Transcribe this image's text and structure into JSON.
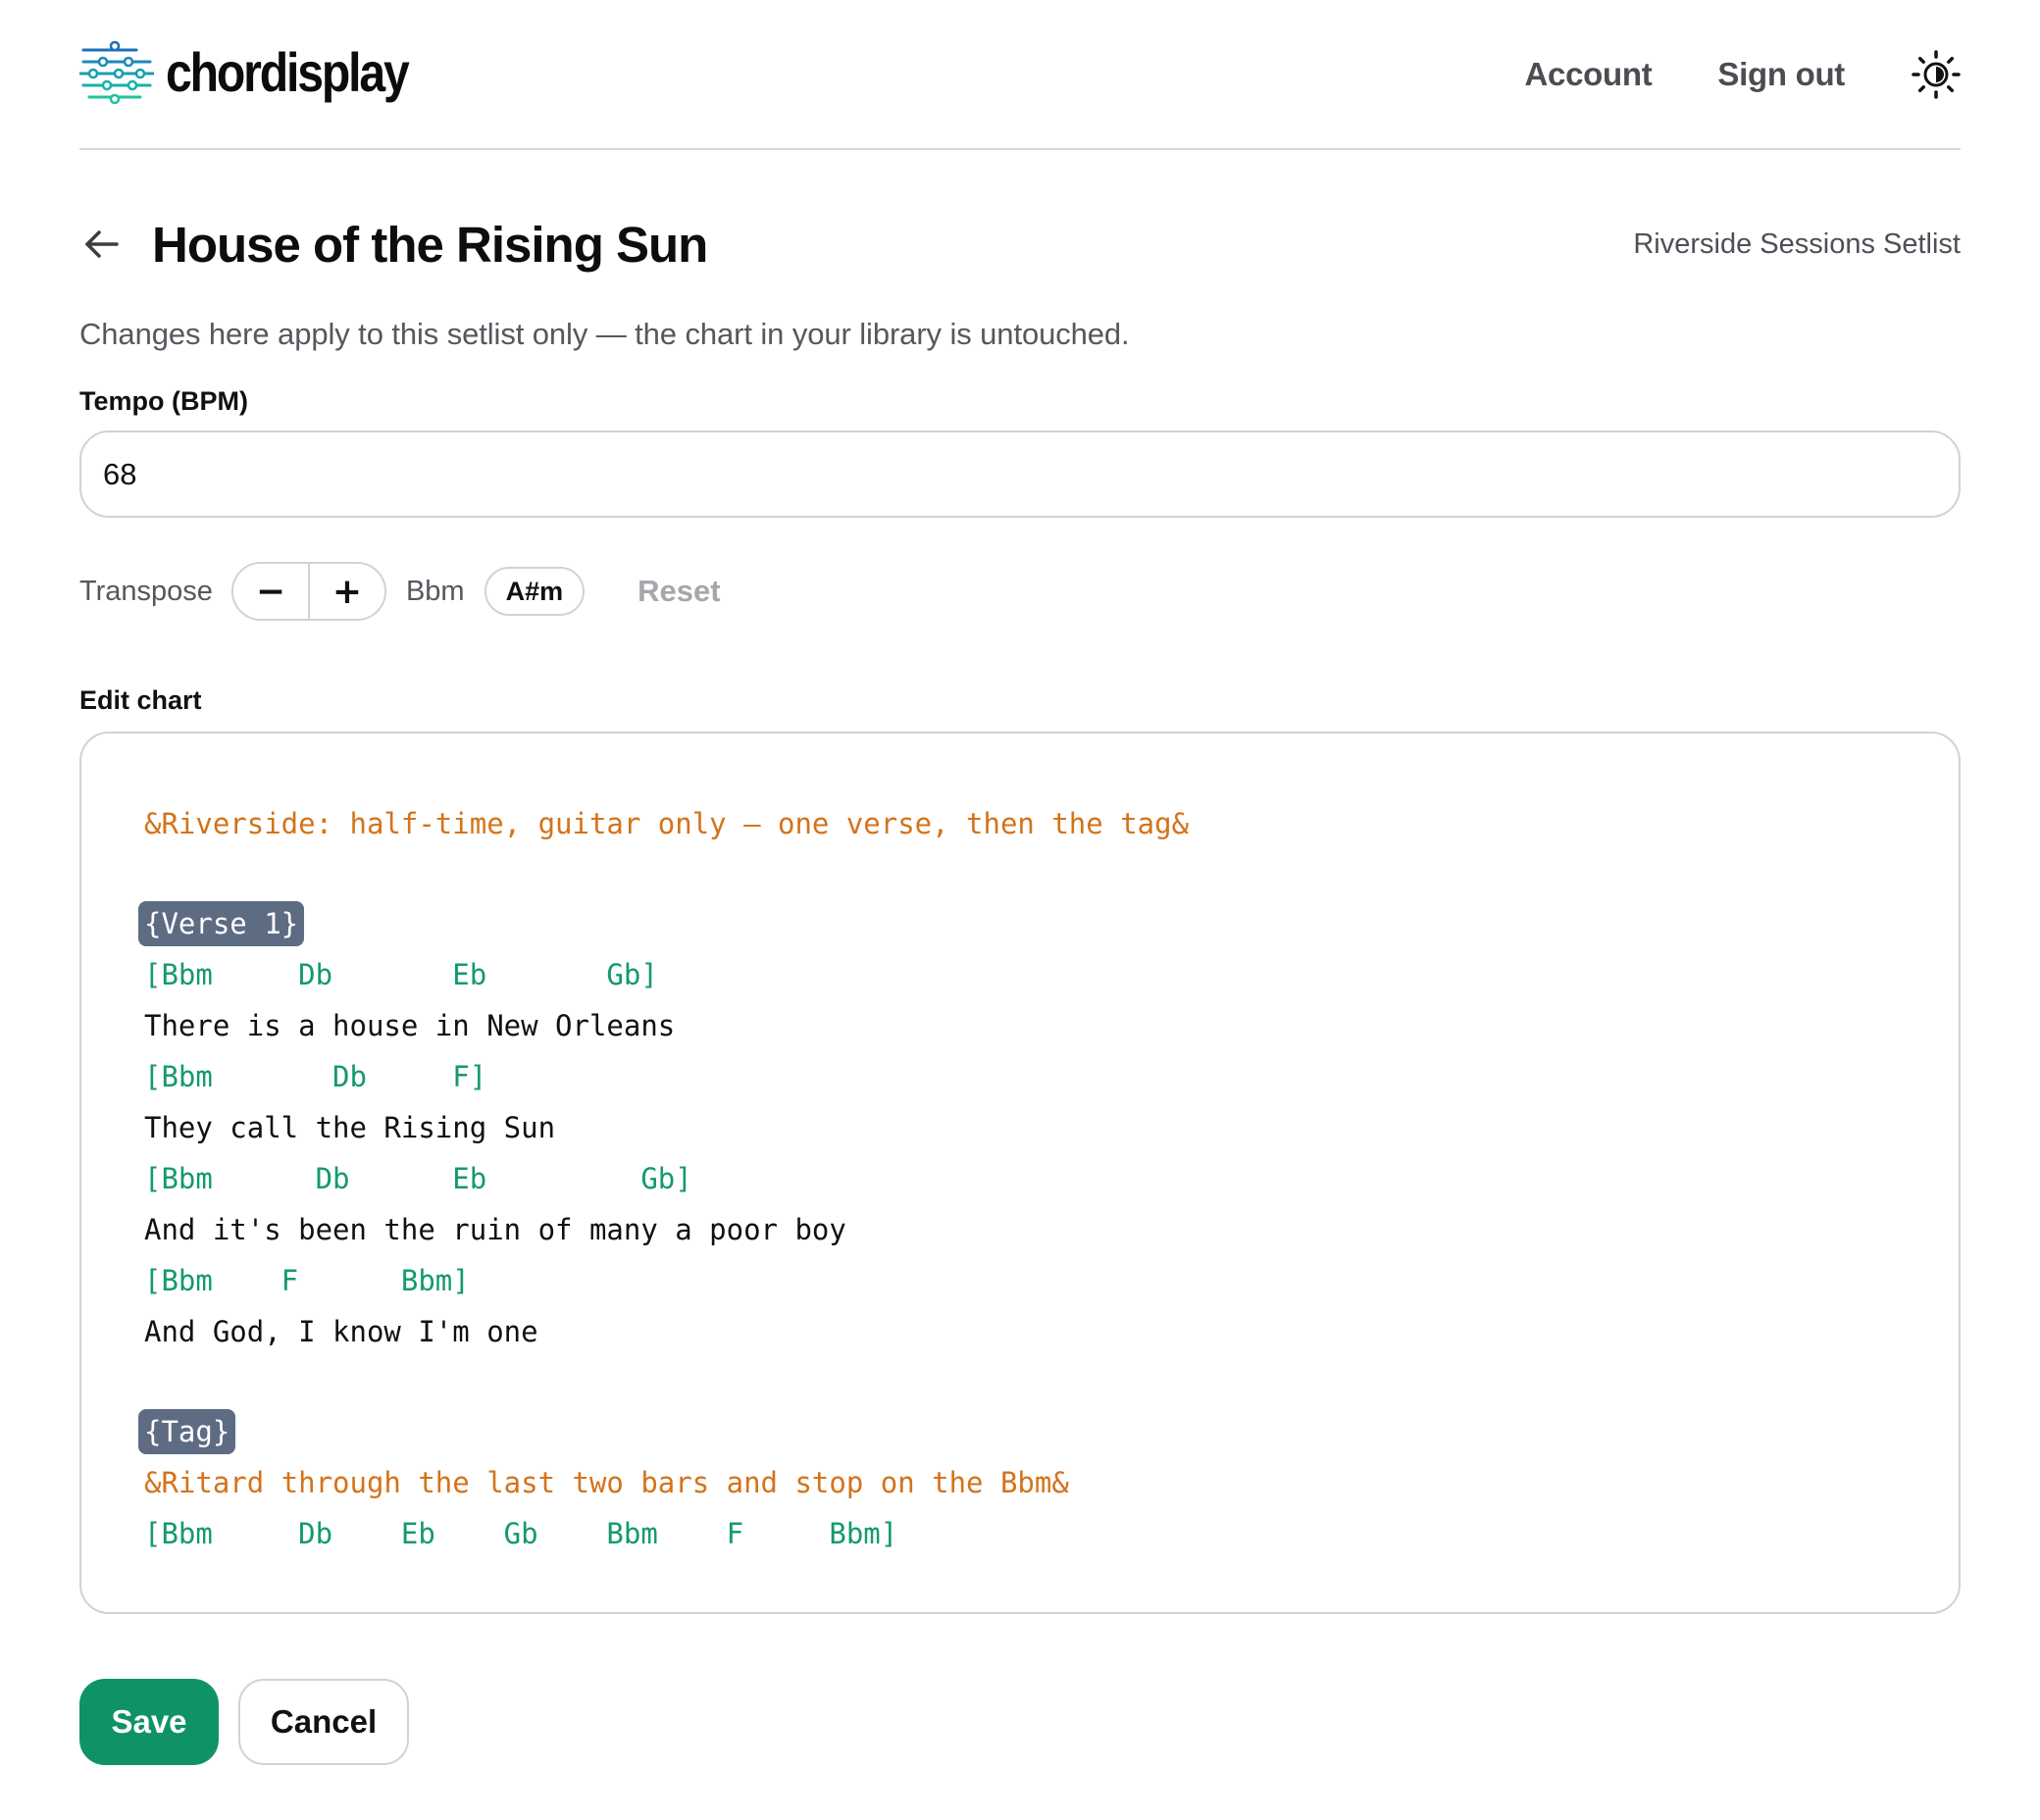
{
  "brand": {
    "name": "chordisplay",
    "logo_icon": "equalizer-sliders-logo"
  },
  "nav": {
    "account": "Account",
    "sign_out": "Sign out",
    "theme_icon": "sun-icon"
  },
  "page": {
    "title": "House of the Rising Sun",
    "setlist_name": "Riverside Sessions Setlist",
    "notice": "Changes here apply to this setlist only — the chart in your library is untouched."
  },
  "tempo": {
    "label": "Tempo (BPM)",
    "value": "68"
  },
  "transpose": {
    "label": "Transpose",
    "minus": "−",
    "plus": "+",
    "original_key": "Bbm",
    "current_key": "A#m",
    "reset": "Reset"
  },
  "editor": {
    "label": "Edit chart",
    "lines": {
      "comment1": "&Riverside: half-time, guitar only — one verse, then the tag&",
      "section1": "{Verse 1}",
      "chords1": "[Bbm     Db       Eb       Gb]",
      "lyric1": "There is a house in New Orleans",
      "chords2": "[Bbm       Db     F]",
      "lyric2": "They call the Rising Sun",
      "chords3": "[Bbm      Db      Eb         Gb]",
      "lyric3": "And it's been the ruin of many a poor boy",
      "chords4": "[Bbm    F      Bbm]",
      "lyric4": "And God, I know I'm one",
      "section2": "{Tag}",
      "comment2": "&Ritard through the last two bars and stop on the Bbm&",
      "chords5": "[Bbm     Db    Eb    Gb    Bbm    F     Bbm]"
    }
  },
  "actions": {
    "save": "Save",
    "cancel": "Cancel"
  },
  "colors": {
    "accent": "#0f9366",
    "chord": "#139a6b",
    "comment": "#d4731b",
    "section_tag": "#5d6b83"
  }
}
